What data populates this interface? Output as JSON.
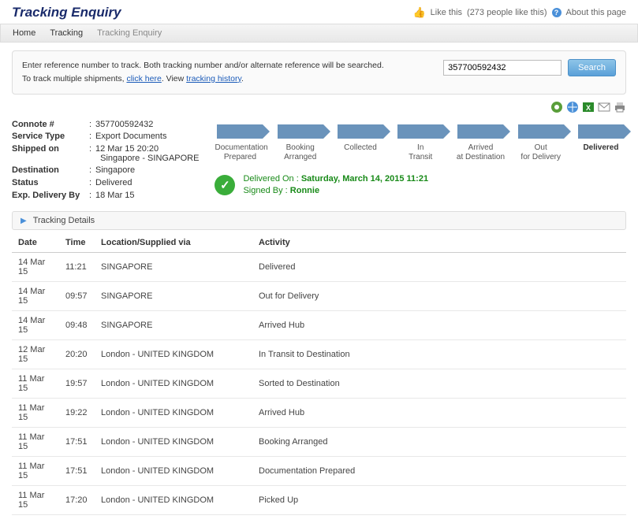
{
  "page_title": "Tracking Enquiry",
  "header": {
    "like_this": "Like this",
    "like_count": "(273 people like this)",
    "about": "About this page"
  },
  "breadcrumb": {
    "home": "Home",
    "tracking": "Tracking",
    "current": "Tracking Enquiry"
  },
  "search": {
    "line1": "Enter reference number to track. Both tracking number and/or alternate reference will be searched.",
    "line2_pre": "To track multiple shipments, ",
    "click_here": "click here",
    "line2_mid": ". View ",
    "tracking_history": "tracking history",
    "line2_post": ".",
    "value": "357700592432",
    "button": "Search"
  },
  "info": {
    "labels": {
      "connote": "Connote #",
      "service": "Service Type",
      "shipped": "Shipped on",
      "destination": "Destination",
      "status": "Status",
      "exp": "Exp. Delivery By"
    },
    "connote": "357700592432",
    "service": "Export Documents",
    "shipped1": "12 Mar 15 20:20",
    "shipped2": "Singapore - SINGAPORE",
    "destination": "Singapore",
    "status": "Delivered",
    "exp": "18 Mar 15"
  },
  "steps": [
    "Documentation Prepared",
    "Booking Arranged",
    "Collected",
    "In Transit",
    "Arrived at Destination",
    "Out for Delivery",
    "Delivered"
  ],
  "delivered": {
    "label": "Delivered On :",
    "date": "Saturday, March 14, 2015 11:21",
    "signed_label": "Signed By :",
    "signed": "Ronnie"
  },
  "details_header": "Tracking Details",
  "table": {
    "headers": [
      "Date",
      "Time",
      "Location/Supplied via",
      "Activity"
    ],
    "rows": [
      [
        "14 Mar 15",
        "11:21",
        "SINGAPORE",
        "Delivered"
      ],
      [
        "14 Mar 15",
        "09:57",
        "SINGAPORE",
        "Out for Delivery"
      ],
      [
        "14 Mar 15",
        "09:48",
        "SINGAPORE",
        "Arrived Hub"
      ],
      [
        "12 Mar 15",
        "20:20",
        "London - UNITED KINGDOM",
        "In Transit to Destination"
      ],
      [
        "11 Mar 15",
        "19:57",
        "London - UNITED KINGDOM",
        "Sorted to Destination"
      ],
      [
        "11 Mar 15",
        "19:22",
        "London - UNITED KINGDOM",
        "Arrived Hub"
      ],
      [
        "11 Mar 15",
        "17:51",
        "London - UNITED KINGDOM",
        "Booking Arranged"
      ],
      [
        "11 Mar 15",
        "17:51",
        "London - UNITED KINGDOM",
        "Documentation Prepared"
      ],
      [
        "11 Mar 15",
        "17:20",
        "London - UNITED KINGDOM",
        "Picked Up"
      ]
    ]
  }
}
